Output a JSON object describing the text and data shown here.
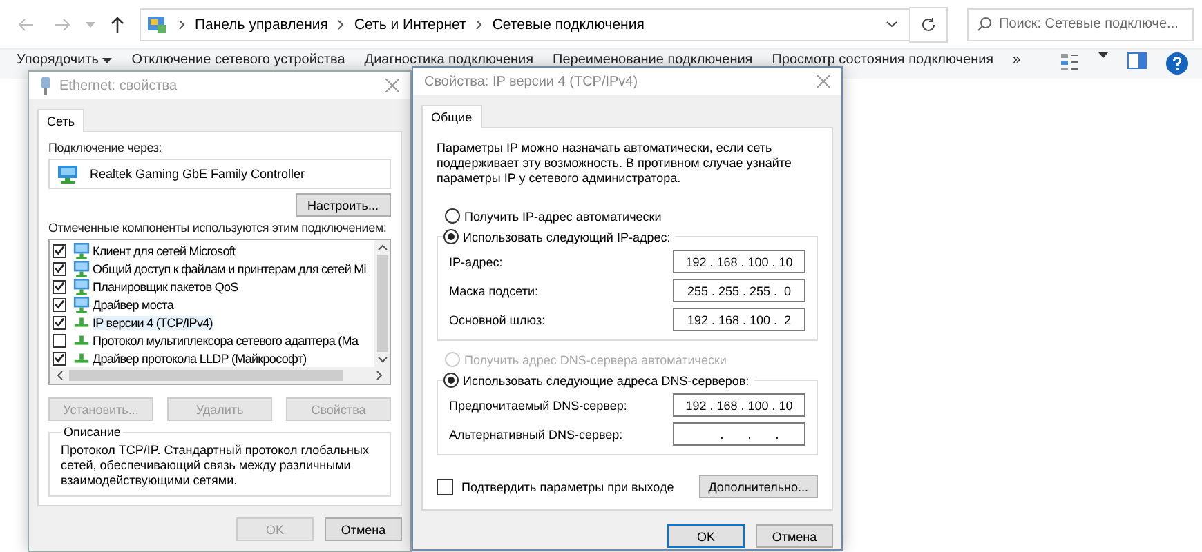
{
  "explorer": {
    "breadcrumb": [
      "Панель управления",
      "Сеть и Интернет",
      "Сетевые подключения"
    ],
    "search": {
      "placeholder": "Поиск: Сетевые подключе..."
    },
    "toolbar": [
      {
        "label": "Упорядочить",
        "kind": "menu"
      },
      {
        "label": "Отключение сетевого устройства",
        "kind": "action"
      },
      {
        "label": "Диагностика подключения",
        "kind": "action"
      },
      {
        "label": "Переименование подключения",
        "kind": "action"
      },
      {
        "label": "Просмотр состояния подключения",
        "kind": "action"
      },
      {
        "label": "»",
        "kind": "more"
      }
    ]
  },
  "ethernet_dialog": {
    "title": "Ethernet: свойства",
    "tabs": [
      {
        "label": "Сеть",
        "selected": true
      }
    ],
    "connect_via_label": "Подключение через:",
    "adapter": "Realtek Gaming GbE Family Controller",
    "configure_button": "Настроить...",
    "components_label": "Отмеченные компоненты используются этим подключением:",
    "components": [
      {
        "label": "Клиент для сетей Microsoft",
        "checked": true,
        "selected": false,
        "kind": "service"
      },
      {
        "label": "Общий доступ к файлам и принтерам для сетей Mi",
        "checked": true,
        "selected": false,
        "kind": "service"
      },
      {
        "label": "Планировщик пакетов QoS",
        "checked": true,
        "selected": false,
        "kind": "service"
      },
      {
        "label": "Драйвер моста",
        "checked": true,
        "selected": false,
        "kind": "service"
      },
      {
        "label": "IP версии 4 (TCP/IPv4)",
        "checked": true,
        "selected": true,
        "kind": "protocol"
      },
      {
        "label": "Протокол мультиплексора сетевого адаптера (Ма",
        "checked": false,
        "selected": false,
        "kind": "protocol"
      },
      {
        "label": "Драйвер протокола LLDP (Майкрософт)",
        "checked": true,
        "selected": false,
        "kind": "protocol"
      }
    ],
    "buttons": [
      {
        "label": "Установить...",
        "disabled": true
      },
      {
        "label": "Удалить",
        "disabled": true
      },
      {
        "label": "Свойства",
        "disabled": true
      }
    ],
    "description": {
      "title": "Описание",
      "text": "Протокол TCP/IP. Стандартный протокол глобальных сетей, обеспечивающий связь между различными взаимодействующими сетями."
    },
    "footer": [
      {
        "label": "OK",
        "disabled": true
      },
      {
        "label": "Отмена",
        "disabled": false
      }
    ]
  },
  "ipv4_dialog": {
    "title": "Свойства: IP версии 4 (TCP/IPv4)",
    "tabs": [
      {
        "label": "Общие",
        "selected": true
      }
    ],
    "intro": "Параметры IP можно назначать автоматически, если сеть поддерживает эту возможность. В противном случае узнайте параметры IP у сетевого администратора.",
    "ip_mode": [
      {
        "label": "Получить IP-адрес автоматически",
        "selected": false,
        "disabled": false
      },
      {
        "label": "Использовать следующий IP-адрес:",
        "selected": true,
        "disabled": false
      }
    ],
    "ip_fields": [
      {
        "label": "IP-адрес:",
        "value": "192 . 168 . 100 . 10"
      },
      {
        "label": "Маска подсети:",
        "value": "255 . 255 . 255 .  0"
      },
      {
        "label": "Основной шлюз:",
        "value": "192 . 168 . 100 .  2"
      }
    ],
    "dns_mode": [
      {
        "label": "Получить адрес DNS-сервера автоматически",
        "selected": false,
        "disabled": true
      },
      {
        "label": "Использовать следующие адреса DNS-серверов:",
        "selected": true,
        "disabled": false
      }
    ],
    "dns_fields": [
      {
        "label": "Предпочитаемый DNS-сервер:",
        "value": "192 . 168 . 100 . 10"
      },
      {
        "label": "Альтернативный DNS-сервер:",
        "value": "      .       .       ."
      }
    ],
    "validate": {
      "label": "Подтвердить параметры при выходе",
      "checked": false
    },
    "advanced_button": "Дополнительно...",
    "footer": [
      {
        "label": "OK"
      },
      {
        "label": "Отмена"
      }
    ]
  }
}
